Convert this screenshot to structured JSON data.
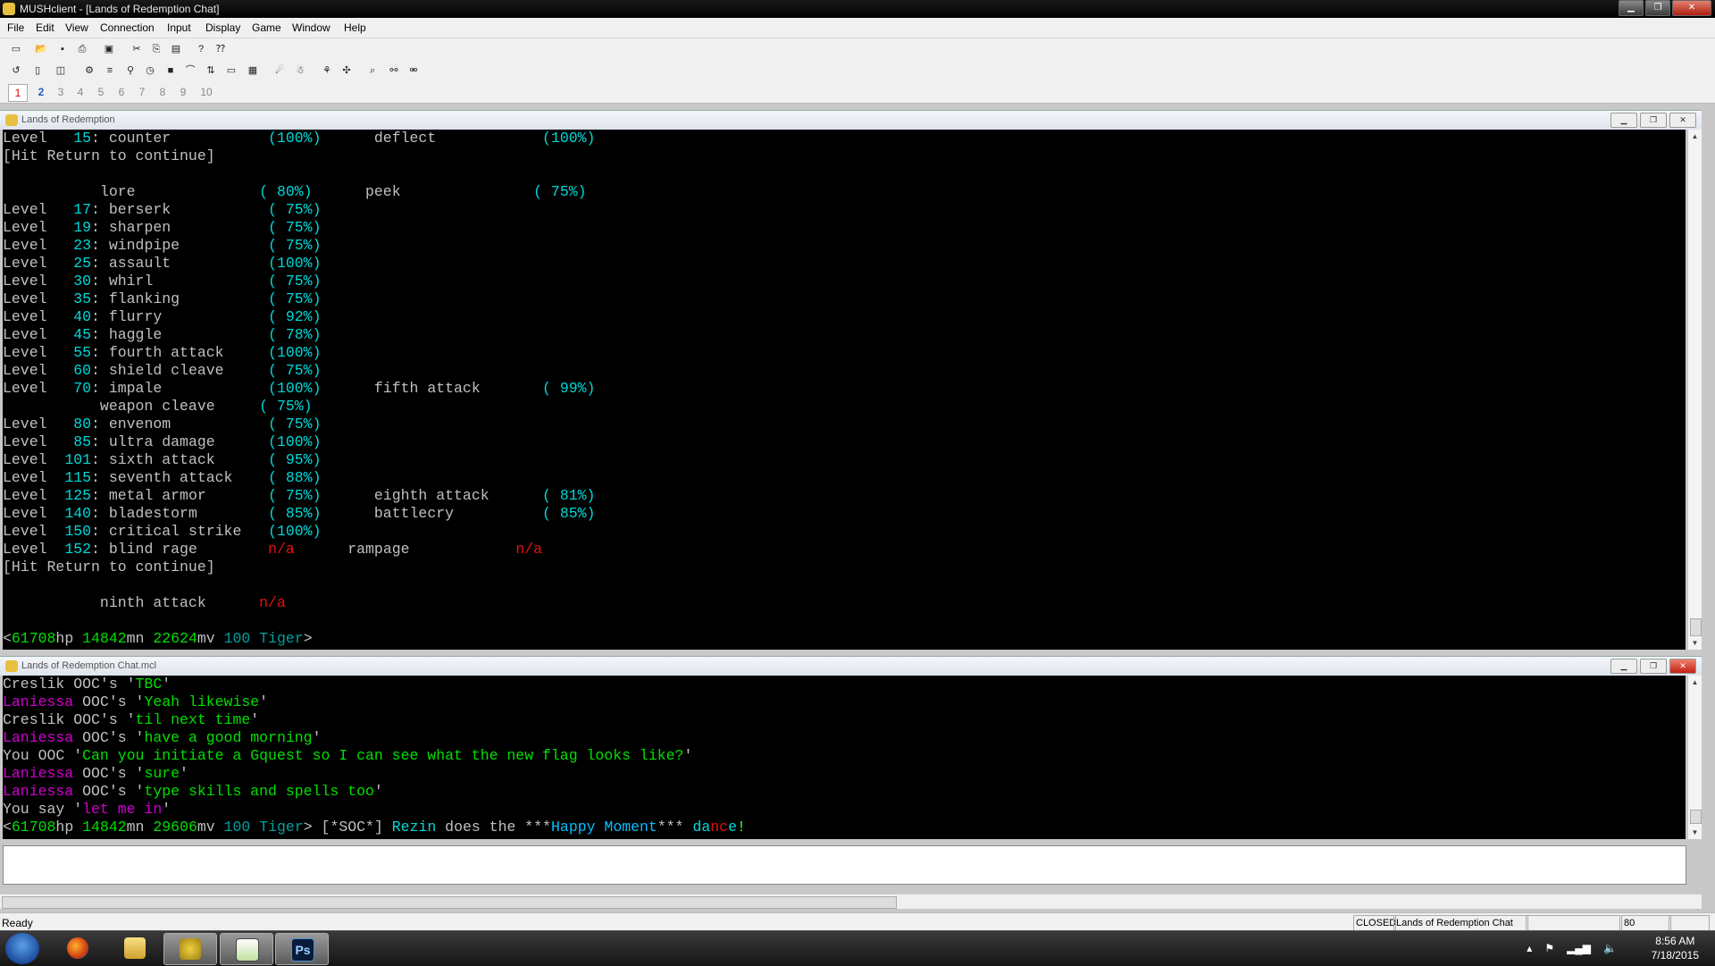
{
  "app": {
    "title": "MUSHclient - [Lands of Redemption Chat]"
  },
  "window_controls": {
    "minimize": "▁",
    "restore": "❐",
    "close": "✕"
  },
  "menu": [
    "File",
    "Edit",
    "View",
    "Connection",
    "Input",
    "Display",
    "Game",
    "Window",
    "Help"
  ],
  "tabs": [
    "1",
    "2",
    "3",
    "4",
    "5",
    "6",
    "7",
    "8",
    "9",
    "10"
  ],
  "main_window": {
    "title": "Lands of Redemption",
    "lines": [
      [
        [
          "Level  ",
          "d"
        ],
        [
          " 15",
          "c"
        ],
        [
          ": counter           ",
          "d"
        ],
        [
          "(100%)",
          "c"
        ],
        [
          "      deflect            ",
          "d"
        ],
        [
          "(100%)",
          "c"
        ]
      ],
      [
        [
          "[Hit Return to continue]",
          "d"
        ]
      ],
      [
        [
          "",
          "d"
        ]
      ],
      [
        [
          "           lore              ",
          "d"
        ],
        [
          "( 80%)",
          "c"
        ],
        [
          "      peek               ",
          "d"
        ],
        [
          "( 75%)",
          "c"
        ]
      ],
      [
        [
          "Level  ",
          "d"
        ],
        [
          " 17",
          "c"
        ],
        [
          ": berserk           ",
          "d"
        ],
        [
          "( 75%)",
          "c"
        ]
      ],
      [
        [
          "Level  ",
          "d"
        ],
        [
          " 19",
          "c"
        ],
        [
          ": sharpen           ",
          "d"
        ],
        [
          "( 75%)",
          "c"
        ]
      ],
      [
        [
          "Level  ",
          "d"
        ],
        [
          " 23",
          "c"
        ],
        [
          ": windpipe          ",
          "d"
        ],
        [
          "( 75%)",
          "c"
        ]
      ],
      [
        [
          "Level  ",
          "d"
        ],
        [
          " 25",
          "c"
        ],
        [
          ": assault           ",
          "d"
        ],
        [
          "(100%)",
          "c"
        ]
      ],
      [
        [
          "Level  ",
          "d"
        ],
        [
          " 30",
          "c"
        ],
        [
          ": whirl             ",
          "d"
        ],
        [
          "( 75%)",
          "c"
        ]
      ],
      [
        [
          "Level  ",
          "d"
        ],
        [
          " 35",
          "c"
        ],
        [
          ": flanking          ",
          "d"
        ],
        [
          "( 75%)",
          "c"
        ]
      ],
      [
        [
          "Level  ",
          "d"
        ],
        [
          " 40",
          "c"
        ],
        [
          ": flurry            ",
          "d"
        ],
        [
          "( 92%)",
          "c"
        ]
      ],
      [
        [
          "Level  ",
          "d"
        ],
        [
          " 45",
          "c"
        ],
        [
          ": haggle            ",
          "d"
        ],
        [
          "( 78%)",
          "c"
        ]
      ],
      [
        [
          "Level  ",
          "d"
        ],
        [
          " 55",
          "c"
        ],
        [
          ": fourth attack     ",
          "d"
        ],
        [
          "(100%)",
          "c"
        ]
      ],
      [
        [
          "Level  ",
          "d"
        ],
        [
          " 60",
          "c"
        ],
        [
          ": shield cleave     ",
          "d"
        ],
        [
          "( 75%)",
          "c"
        ]
      ],
      [
        [
          "Level  ",
          "d"
        ],
        [
          " 70",
          "c"
        ],
        [
          ": impale            ",
          "d"
        ],
        [
          "(100%)",
          "c"
        ],
        [
          "      fifth attack       ",
          "d"
        ],
        [
          "( 99%)",
          "c"
        ]
      ],
      [
        [
          "           weapon cleave     ",
          "d"
        ],
        [
          "( 75%)",
          "c"
        ]
      ],
      [
        [
          "Level  ",
          "d"
        ],
        [
          " 80",
          "c"
        ],
        [
          ": envenom           ",
          "d"
        ],
        [
          "( 75%)",
          "c"
        ]
      ],
      [
        [
          "Level  ",
          "d"
        ],
        [
          " 85",
          "c"
        ],
        [
          ": ultra damage      ",
          "d"
        ],
        [
          "(100%)",
          "c"
        ]
      ],
      [
        [
          "Level  ",
          "d"
        ],
        [
          "101",
          "c"
        ],
        [
          ": sixth attack      ",
          "d"
        ],
        [
          "( 95%)",
          "c"
        ]
      ],
      [
        [
          "Level  ",
          "d"
        ],
        [
          "115",
          "c"
        ],
        [
          ": seventh attack    ",
          "d"
        ],
        [
          "( 88%)",
          "c"
        ]
      ],
      [
        [
          "Level  ",
          "d"
        ],
        [
          "125",
          "c"
        ],
        [
          ": metal armor       ",
          "d"
        ],
        [
          "( 75%)",
          "c"
        ],
        [
          "      eighth attack      ",
          "d"
        ],
        [
          "( 81%)",
          "c"
        ]
      ],
      [
        [
          "Level  ",
          "d"
        ],
        [
          "140",
          "c"
        ],
        [
          ": bladestorm        ",
          "d"
        ],
        [
          "( 85%)",
          "c"
        ],
        [
          "      battlecry          ",
          "d"
        ],
        [
          "( 85%)",
          "c"
        ]
      ],
      [
        [
          "Level  ",
          "d"
        ],
        [
          "150",
          "c"
        ],
        [
          ": critical strike   ",
          "d"
        ],
        [
          "(100%)",
          "c"
        ]
      ],
      [
        [
          "Level  ",
          "d"
        ],
        [
          "152",
          "c"
        ],
        [
          ": blind rage        ",
          "d"
        ],
        [
          "n/a",
          "r"
        ],
        [
          "      rampage            ",
          "d"
        ],
        [
          "n/a",
          "r"
        ]
      ],
      [
        [
          "[Hit Return to continue]",
          "d"
        ]
      ],
      [
        [
          "",
          "d"
        ]
      ],
      [
        [
          "           ninth attack      ",
          "d"
        ],
        [
          "n/a",
          "r"
        ]
      ],
      [
        [
          "",
          "d"
        ]
      ],
      [
        [
          "<",
          "d"
        ],
        [
          "61708",
          "g"
        ],
        [
          "hp ",
          "d"
        ],
        [
          "14842",
          "g"
        ],
        [
          "mn ",
          "d"
        ],
        [
          "22624",
          "g"
        ],
        [
          "mv ",
          "d"
        ],
        [
          "100 Tiger",
          "t"
        ],
        [
          ">",
          "d"
        ]
      ]
    ]
  },
  "chat_window": {
    "title": "Lands of Redemption Chat.mcl",
    "lines": [
      [
        [
          "Creslik OOC's '",
          "d"
        ],
        [
          "TBC",
          "g"
        ],
        [
          "'",
          "d"
        ]
      ],
      [
        [
          "Laniessa",
          "m"
        ],
        [
          " OOC's '",
          "d"
        ],
        [
          "Yeah likewise",
          "g"
        ],
        [
          "'",
          "d"
        ]
      ],
      [
        [
          "Creslik OOC's '",
          "d"
        ],
        [
          "til next time",
          "g"
        ],
        [
          "'",
          "d"
        ]
      ],
      [
        [
          "Laniessa",
          "m"
        ],
        [
          " OOC's '",
          "d"
        ],
        [
          "have a good morning",
          "g"
        ],
        [
          "'",
          "d"
        ]
      ],
      [
        [
          "You OOC '",
          "d"
        ],
        [
          "Can you initiate a Gquest so I can see what the new flag looks like?",
          "g"
        ],
        [
          "'",
          "d"
        ]
      ],
      [
        [
          "Laniessa",
          "m"
        ],
        [
          " OOC's '",
          "d"
        ],
        [
          "sure",
          "g"
        ],
        [
          "'",
          "d"
        ]
      ],
      [
        [
          "Laniessa",
          "m"
        ],
        [
          " OOC's '",
          "d"
        ],
        [
          "type skills and spells too",
          "g"
        ],
        [
          "'",
          "d"
        ]
      ],
      [
        [
          "You say '",
          "d"
        ],
        [
          "let me in",
          "m"
        ],
        [
          "'",
          "d"
        ]
      ],
      [
        [
          "<",
          "d"
        ],
        [
          "61708",
          "g"
        ],
        [
          "hp ",
          "d"
        ],
        [
          "14842",
          "g"
        ],
        [
          "mn ",
          "d"
        ],
        [
          "29606",
          "g"
        ],
        [
          "mv ",
          "d"
        ],
        [
          "100 Tiger",
          "t"
        ],
        [
          "> [*SOC*] ",
          "d"
        ],
        [
          "Rezin",
          "c"
        ],
        [
          " does the ***",
          "d"
        ],
        [
          "Happy Moment",
          "b"
        ],
        [
          "*** ",
          "d"
        ],
        [
          "da",
          "c"
        ],
        [
          "nc",
          "r"
        ],
        [
          "e",
          "c"
        ],
        [
          "!",
          "lg"
        ]
      ]
    ]
  },
  "statusbar": {
    "ready": "Ready",
    "closed": "CLOSED",
    "world": "Lands of Redemption Chat",
    "count": "80"
  },
  "taskbar": {
    "ps_label": "Ps"
  },
  "clock": {
    "time": "8:56 AM",
    "date": "7/18/2015"
  }
}
